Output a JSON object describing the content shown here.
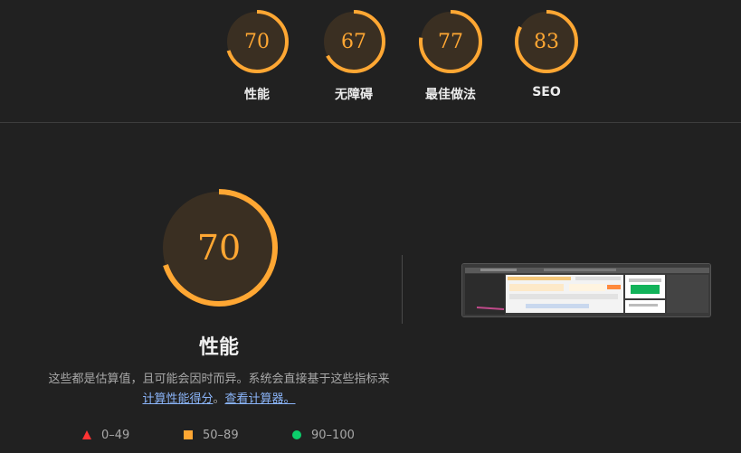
{
  "categories": [
    {
      "label": "性能",
      "score": "70",
      "fraction": 0.7
    },
    {
      "label": "无障碍",
      "score": "67",
      "fraction": 0.67
    },
    {
      "label": "最佳做法",
      "score": "77",
      "fraction": 0.77
    },
    {
      "label": "SEO",
      "score": "83",
      "fraction": 0.83
    }
  ],
  "main": {
    "score": "70",
    "fraction": 0.7,
    "title": "性能",
    "description_prefix": "这些都是估算值，且可能会因时而异。系统会直接基于这些指标来",
    "link_calc": "计算性能得分",
    "separator": "。",
    "link_calculator": "查看计算器。"
  },
  "legend": [
    {
      "label": "0–49",
      "color": "#ff3333",
      "shape": "triangle"
    },
    {
      "label": "50–89",
      "color": "#ffa733",
      "shape": "square"
    },
    {
      "label": "90–100",
      "color": "#0cce6b",
      "shape": "circle"
    }
  ],
  "colors": {
    "accent": "#ffa733",
    "gauge_fill": "#3a2f22",
    "background": "#212121"
  }
}
